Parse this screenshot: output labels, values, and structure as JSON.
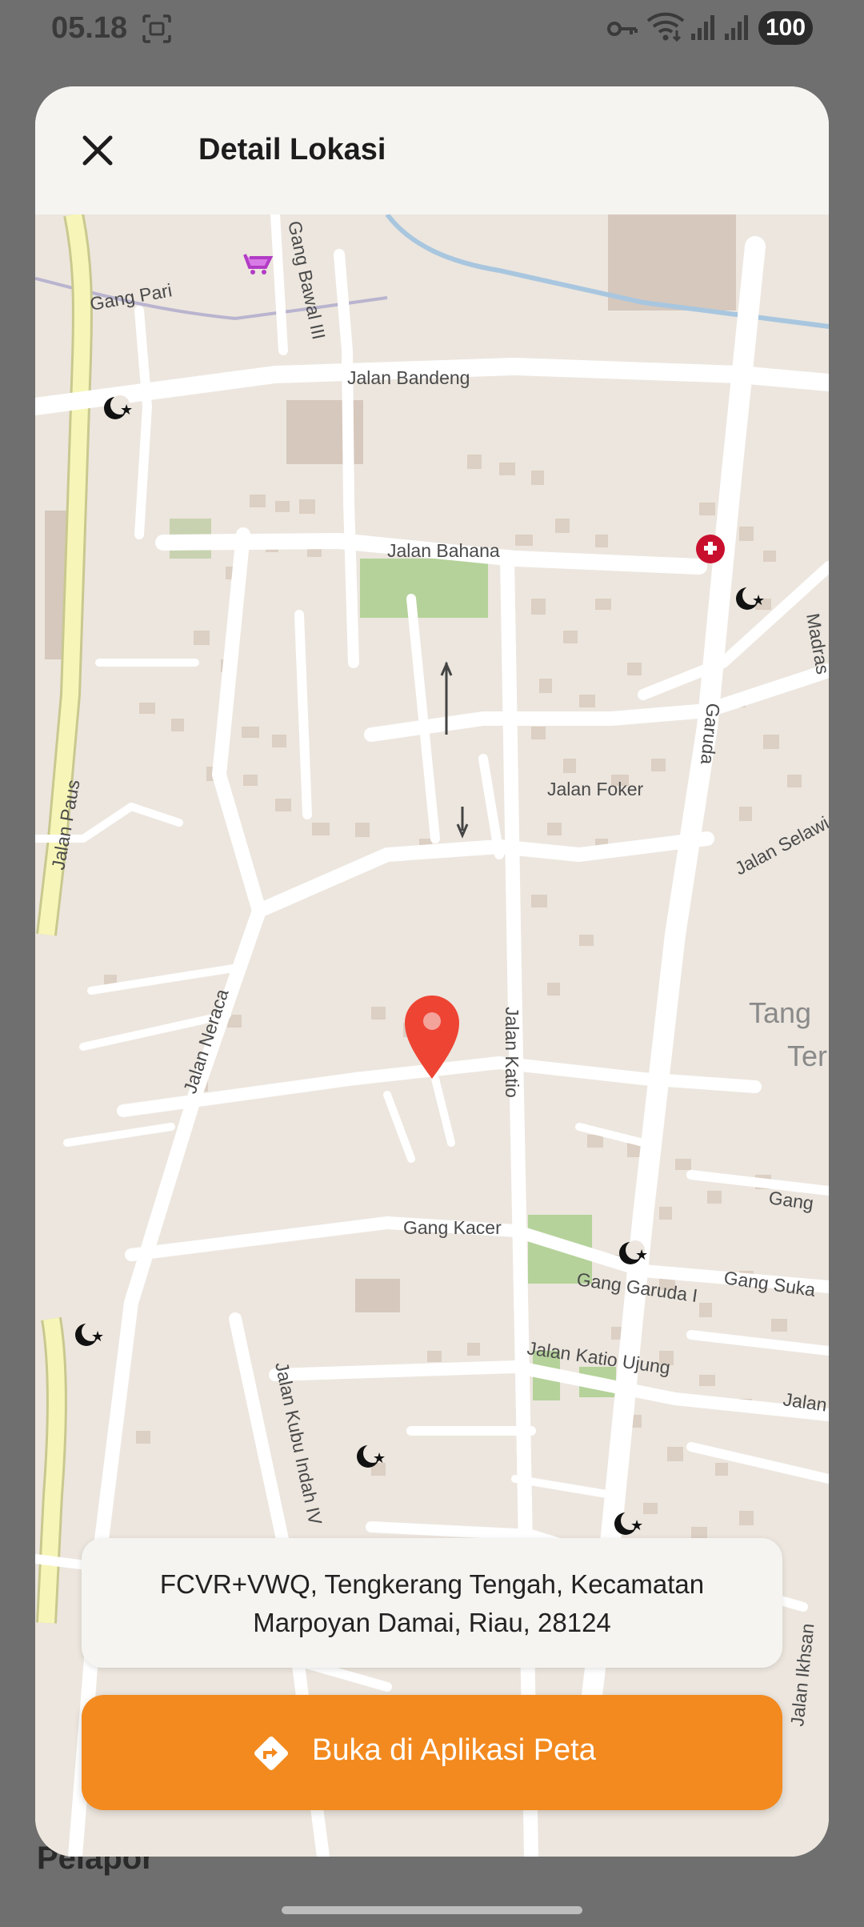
{
  "status_bar": {
    "time": "05.18",
    "battery": "100",
    "icons": [
      "screenshot-icon",
      "vpn-key-icon",
      "wifi-icon",
      "signal-icon",
      "signal-icon"
    ]
  },
  "sheet": {
    "title": "Detail Lokasi",
    "close_icon": "close-icon"
  },
  "map": {
    "street_labels": [
      "Gang Pari",
      "Gang Bawal III",
      "Jalan Bandeng",
      "Jalan Bahana",
      "Jalan Foker",
      "Garuda",
      "Jalan Paus",
      "Jalan Neraca",
      "Jalan Katio",
      "Gang Kacer",
      "Gang Garuda I",
      "Jalan Katio Ujung",
      "Gang Suka",
      "Jalan Kubu Indah IV",
      "Jalan Ikhsan",
      "Jalan Selawi",
      "Madras",
      "Tang",
      "Ter",
      "Gang",
      "Jalan"
    ],
    "marker_icon": "location-pin-icon",
    "poi_icons": [
      "mosque-icon",
      "hospital-icon",
      "shop-icon"
    ]
  },
  "address": {
    "line1": "FCVR+VWQ, Tengkerang Tengah, Kecamatan",
    "line2": "Marpoyan Damai, Riau, 28124"
  },
  "action": {
    "label": "Buka di Aplikasi Peta",
    "icon": "directions-icon"
  },
  "background": {
    "partial_text": "Pelapor"
  },
  "colors": {
    "accent": "#f38a1f",
    "marker": "#ee4434",
    "map_bg": "#ece6de"
  }
}
